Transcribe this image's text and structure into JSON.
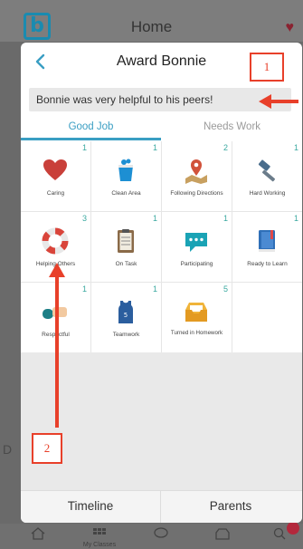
{
  "background": {
    "header_title": "Home",
    "logo_letter": "b",
    "left_edge_letter": "D",
    "tab_labels": [
      "",
      "My Classes",
      "",
      "",
      ""
    ]
  },
  "modal": {
    "title": "Award Bonnie",
    "note": "Bonnie was very helpful to his peers!",
    "tabs": [
      {
        "label": "Good Job",
        "active": true
      },
      {
        "label": "Needs Work",
        "active": false
      }
    ],
    "skills": [
      {
        "label": "Caring",
        "count": "1",
        "icon": "heart-icon"
      },
      {
        "label": "Clean Area",
        "count": "1",
        "icon": "bucket-icon"
      },
      {
        "label": "Following Directions",
        "count": "2",
        "icon": "map-pin-icon"
      },
      {
        "label": "Hard Working",
        "count": "1",
        "icon": "hammer-icon"
      },
      {
        "label": "Helping Others",
        "count": "3",
        "icon": "life-ring-icon"
      },
      {
        "label": "On Task",
        "count": "1",
        "icon": "clipboard-icon"
      },
      {
        "label": "Participating",
        "count": "1",
        "icon": "chat-bubble-icon"
      },
      {
        "label": "Ready to Learn",
        "count": "1",
        "icon": "book-icon"
      },
      {
        "label": "Respectful",
        "count": "1",
        "icon": "handshake-icon"
      },
      {
        "label": "Teamwork",
        "count": "1",
        "icon": "jersey-icon"
      },
      {
        "label": "Turned in Homework",
        "count": "5",
        "icon": "inbox-icon"
      }
    ],
    "bottom_tabs": [
      "Timeline",
      "Parents"
    ]
  },
  "annotations": {
    "callout_1": "1",
    "callout_2": "2"
  },
  "colors": {
    "accent": "#3a9ec3",
    "annotation": "#e8402a",
    "count_teal": "#3aa9a0"
  }
}
